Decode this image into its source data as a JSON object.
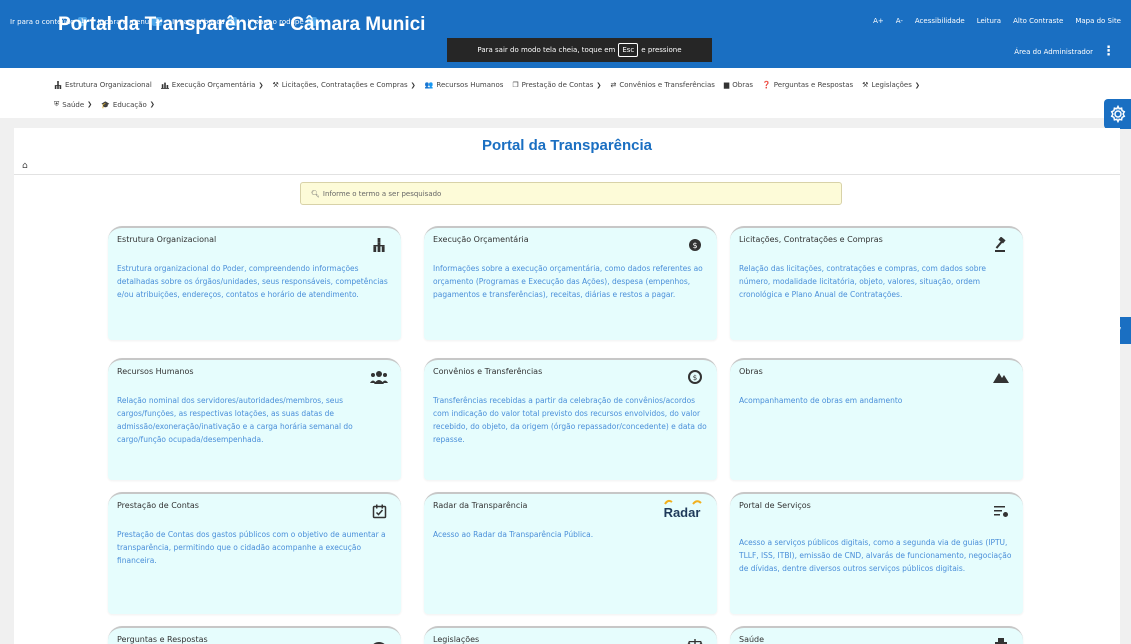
{
  "skip_links": [
    {
      "label": "Ir para o conteúdo",
      "key": "1"
    },
    {
      "label": "Ir para o menu",
      "key": "2"
    },
    {
      "label": "Ir para a busca",
      "key": "3"
    },
    {
      "label": "Ir para o rodapé",
      "key": "4"
    }
  ],
  "accessibility": {
    "font_up": "A+",
    "font_down": "A-",
    "accessibility": "Acessibilidade",
    "reading": "Leitura",
    "high_contrast": "Alto Contraste",
    "sitemap": "Mapa do Site"
  },
  "header": {
    "title": "Portal da Transparência - Câmara Munici",
    "admin": "Área do Administrador"
  },
  "fullscreen_toast": {
    "before": "Para sair do modo tela cheia, toque em",
    "key": "Esc",
    "after": "e pressione"
  },
  "nav": {
    "row1": [
      {
        "label": "Estrutura Organizacional",
        "icon": "sitemap-icon",
        "dropdown": false
      },
      {
        "label": "Execução Orçamentária",
        "icon": "chart-icon",
        "dropdown": true
      },
      {
        "label": "Licitações, Contratações e Compras",
        "icon": "gavel-icon",
        "dropdown": true
      },
      {
        "label": "Recursos Humanos",
        "icon": "users-icon",
        "dropdown": false
      },
      {
        "label": "Prestação de Contas",
        "icon": "copy-icon",
        "dropdown": true
      },
      {
        "label": "Convênios e Transferências",
        "icon": "exchange-icon",
        "dropdown": false
      },
      {
        "label": "Obras",
        "icon": "building-icon",
        "dropdown": false
      },
      {
        "label": "Perguntas e Respostas",
        "icon": "question-icon",
        "dropdown": false
      },
      {
        "label": "Legislações",
        "icon": "hammer-icon",
        "dropdown": true
      }
    ],
    "row2": [
      {
        "label": "Saúde",
        "icon": "hospital-icon",
        "dropdown": true
      },
      {
        "label": "Educação",
        "icon": "graduation-icon",
        "dropdown": true
      }
    ]
  },
  "page": {
    "title": "Portal da Transparência",
    "search_placeholder": "Informe o termo a ser pesquisado"
  },
  "cards": [
    {
      "title": "Estrutura Organizacional",
      "icon": "sitemap-icon",
      "desc": "Estrutura organizacional do Poder, compreendendo informações detalhadas sobre os órgãos/unidades, seus responsáveis, competências e/ou atribuições, endereços, contatos e horário de atendimento."
    },
    {
      "title": "Execução Orçamentária",
      "icon": "coin-icon",
      "desc": "Informações sobre a execução orçamentária, como dados referentes ao orçamento (Programas e Execução das Ações), despesa (empenhos, pagamentos e transferências), receitas, diárias e restos a pagar."
    },
    {
      "title": "Licitações, Contratações e Compras",
      "icon": "gavel-icon",
      "desc": "Relação das licitações, contratações e compras, com dados sobre número, modalidade licitatória, objeto, valores, situação, ordem cronológica e Plano Anual de Contratações."
    },
    {
      "title": "Recursos Humanos",
      "icon": "users-icon",
      "desc": "Relação nominal dos servidores/autoridades/membros, seus cargos/funções, as respectivas lotações, as suas datas de admissão/exoneração/inativação e a carga horária semanal do cargo/função ocupada/desempenhada."
    },
    {
      "title": "Convênios e Transferências",
      "icon": "transfer-icon",
      "desc": "Transferências recebidas a partir da celebração de convênios/acordos com indicação do valor total previsto dos recursos envolvidos, do valor recebido, do objeto, da origem (órgão repassador/concedente) e data do repasse."
    },
    {
      "title": "Obras",
      "icon": "mountain-icon",
      "desc": "Acompanhamento de obras em andamento"
    },
    {
      "title": "Prestação de Contas",
      "icon": "calendar-check-icon",
      "desc": "Prestação de Contas dos gastos públicos com o objetivo de aumentar a transparência, permitindo que o cidadão acompanhe a execução financeira."
    },
    {
      "title": "Radar da Transparência",
      "icon": "radar-logo",
      "logo_text": "Radar",
      "desc": "Acesso ao Radar da Transparência Pública."
    },
    {
      "title": "Portal de Serviços",
      "icon": "services-icon",
      "desc": "Acesso a serviços públicos digitais, como a segunda via de guias (IPTU, TLLF, ISS, ITBI), emissão de CND, alvarás de funcionamento, negociação de dívidas, dentre diversos outros serviços públicos digitais."
    },
    {
      "title": "Perguntas e Respostas",
      "icon": "chat-icon",
      "desc": ""
    },
    {
      "title": "Legislações",
      "icon": "scales-icon",
      "desc": ""
    },
    {
      "title": "Saúde",
      "icon": "hospital-icon",
      "desc": ""
    }
  ],
  "colors": {
    "brand": "#1a6fc2",
    "card_bg": "#e6fdfd",
    "card_text": "#4a8fd9",
    "search_bg": "#fdfbd8"
  }
}
